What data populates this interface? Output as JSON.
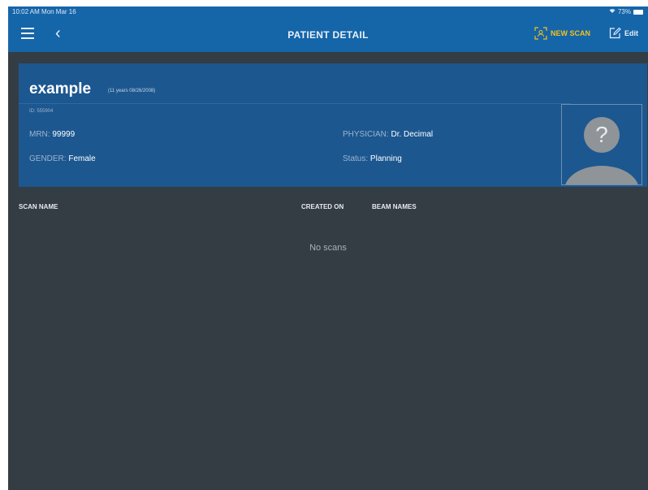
{
  "status_bar": {
    "time": "10:02 AM  Mon Mar 16",
    "battery": "73%"
  },
  "nav": {
    "title": "PATIENT DETAIL",
    "new_scan_label": "NEW SCAN",
    "edit_label": "Edit"
  },
  "patient": {
    "name": "example",
    "age_dob": "(11 years 08/26/2008)",
    "id": "ID: 555904",
    "mrn_label": "MRN:",
    "mrn_value": "99999",
    "gender_label": "GENDER:",
    "gender_value": "Female",
    "physician_label": "PHYSICIAN:",
    "physician_value": "Dr. Decimal",
    "status_label": "Status:",
    "status_value": "Planning",
    "photo_placeholder": "?"
  },
  "scans_table": {
    "columns": [
      "SCAN NAME",
      "CREATED ON",
      "BEAM NAMES"
    ],
    "empty_message": "No scans"
  },
  "colors": {
    "nav_blue": "#1565a9",
    "card_blue": "#1c5790",
    "background": "#343c44",
    "accent_yellow": "#f3c21b"
  }
}
